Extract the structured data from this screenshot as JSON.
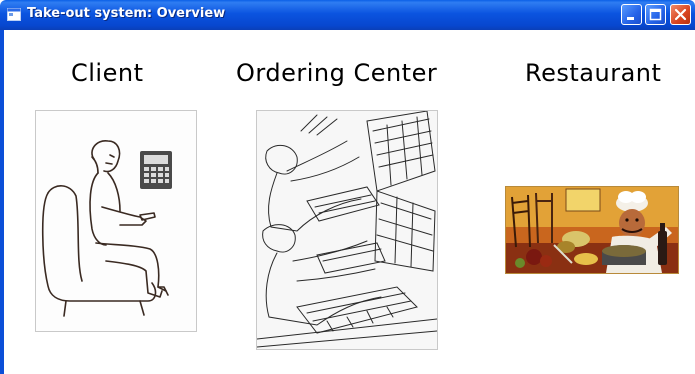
{
  "window": {
    "title": "Take-out system: Overview",
    "titlebar_color": "#0b54e0",
    "buttons": [
      "minimize-icon",
      "maximize-icon",
      "close-icon"
    ]
  },
  "sections": [
    {
      "label": "Client",
      "image": "client-sketch-image"
    },
    {
      "label": "Ordering Center",
      "image": "ordering-center-sketch-image"
    },
    {
      "label": "Restaurant",
      "image": "restaurant-painting-image"
    }
  ]
}
